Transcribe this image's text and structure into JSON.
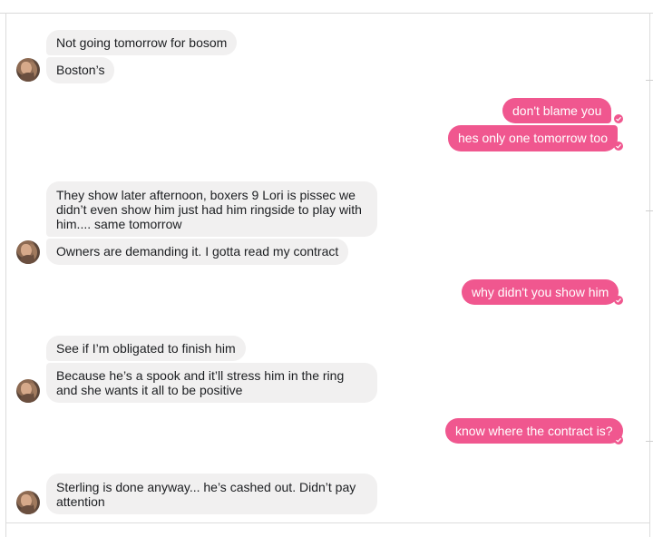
{
  "colors": {
    "incoming_bubble": "#f1f0f0",
    "outgoing_bubble": "#f0578f",
    "incoming_text": "#1c1e21",
    "outgoing_text": "#ffffff"
  },
  "icons": {
    "avatar": "contact-avatar",
    "seen": "seen-check-icon"
  },
  "messages": [
    {
      "side": "in",
      "text": "Not going tomorrow for bosom"
    },
    {
      "side": "in",
      "text": "Boston’s"
    },
    {
      "side": "out",
      "text": "don't blame  you"
    },
    {
      "side": "out",
      "text": "hes only one tomorrow too"
    },
    {
      "side": "in",
      "text": "They show later afternoon, boxers 9 Lori is pissec we didn’t even show him just had him ringside to play with him.... same tomorrow"
    },
    {
      "side": "in",
      "text": "Owners are demanding it. I gotta read my contract"
    },
    {
      "side": "out",
      "text": "why didn't you show him"
    },
    {
      "side": "in",
      "text": "See if I’m obligated to finish him"
    },
    {
      "side": "in",
      "text": "Because he’s a spook and it’ll stress him in the ring and she wants it all to be positive"
    },
    {
      "side": "out",
      "text": "know where the contract is?"
    },
    {
      "side": "in",
      "text": "Sterling is done anyway... he’s cashed out. Didn’t pay attention"
    }
  ]
}
